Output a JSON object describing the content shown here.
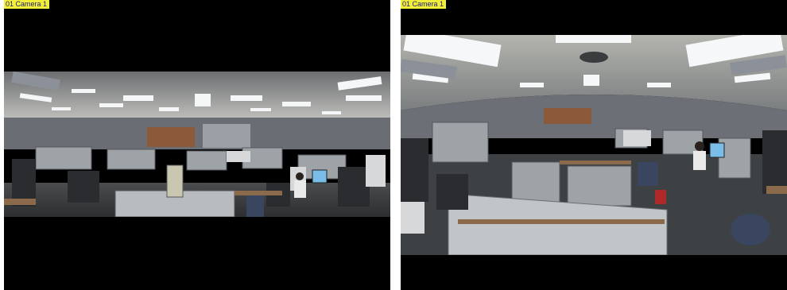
{
  "cameras": [
    {
      "label": "01 Camera 1",
      "view": "panorama"
    },
    {
      "label": "01 Camera 1",
      "view": "fisheye-perimeter"
    }
  ],
  "colors": {
    "background": "#000000",
    "label_background": "#f2ef3a",
    "label_text": "#1a1a7a"
  }
}
